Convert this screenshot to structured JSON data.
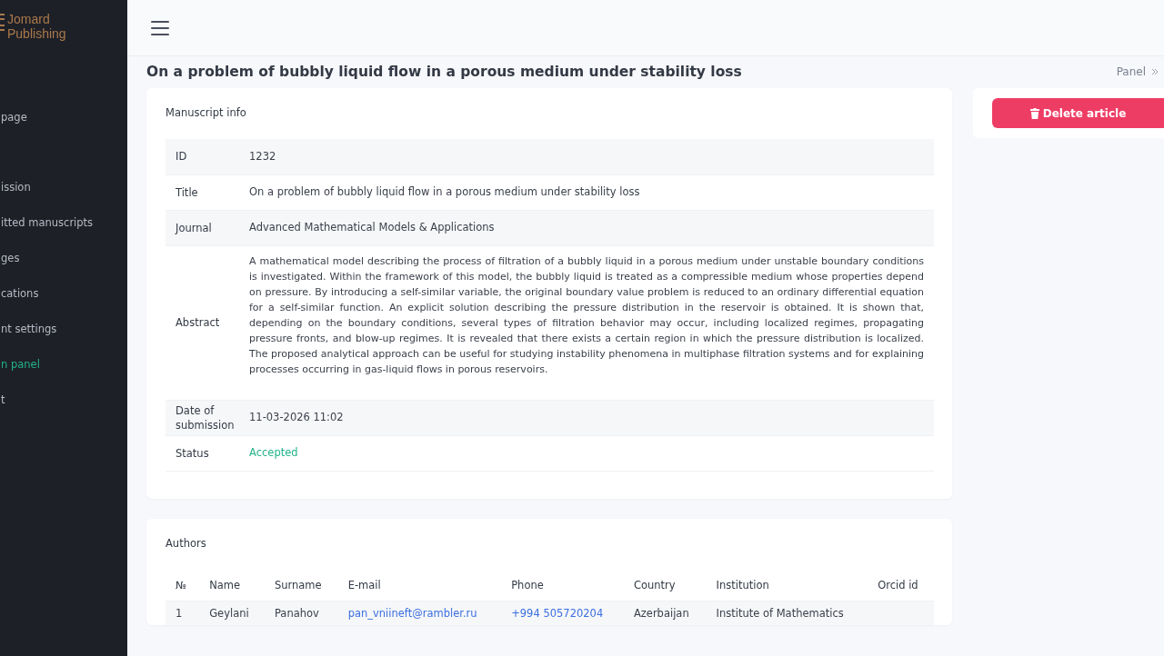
{
  "logo": {
    "lines": [
      "Jomard",
      "Publishing"
    ]
  },
  "sidebar": {
    "groups": [
      {
        "items": [
          {
            "label": "page",
            "selected": false
          }
        ]
      },
      {
        "items": [
          {
            "label": "ission",
            "selected": false
          },
          {
            "label": "itted manuscripts",
            "selected": false
          },
          {
            "label": "ges",
            "selected": false
          },
          {
            "label": "cations",
            "selected": false
          },
          {
            "label": "nt settings",
            "selected": false
          },
          {
            "label": "n panel",
            "selected": true
          },
          {
            "label": "t",
            "selected": false
          }
        ]
      }
    ]
  },
  "page_title": "On a problem of bubbly liquid flow in a porous medium under stability loss",
  "breadcrumb": "Panel",
  "delete_button": "Delete article",
  "manuscript": {
    "heading": "Manuscript info",
    "rows": [
      {
        "label": "ID",
        "value": "1232",
        "kind": "text"
      },
      {
        "label": "Title",
        "value": "On a problem of bubbly liquid flow in a porous medium under stability loss",
        "kind": "text"
      },
      {
        "label": "Journal",
        "value": "Advanced Mathematical Models & Applications",
        "kind": "text"
      },
      {
        "label": "Abstract",
        "value": "A mathematical model describing the process of filtration of a bubbly liquid in a porous medium under unstable boundary conditions is investigated. Within the framework of this model, the bubbly liquid is treated as a compressible medium whose properties depend on pressure. By introducing a self-similar variable, the original boundary value problem is reduced to an ordinary differential equation for a self-similar function. An explicit solution describing the pressure distribution in the reservoir is obtained. It is shown that, depending on the boundary conditions, several types of filtration behavior may occur, including localized regimes, propagating pressure fronts, and blow-up regimes. It is revealed that there exists a certain region in which the pressure distribution is localized. The proposed analytical approach can be useful for studying instability phenomena in multiphase filtration systems and for explaining processes occurring in gas-liquid flows in porous reservoirs.",
        "kind": "abstract"
      },
      {
        "label": "Date of submission",
        "value": "11-03-2026 11:02",
        "kind": "text"
      },
      {
        "label": "Status",
        "value": "Accepted",
        "kind": "status"
      }
    ]
  },
  "authors": {
    "heading": "Authors",
    "columns": [
      "№",
      "Name",
      "Surname",
      "E-mail",
      "Phone",
      "Country",
      "Institution",
      "Orcid id"
    ],
    "rows": [
      {
        "cells": [
          {
            "text": "1",
            "kind": "text"
          },
          {
            "text": "Geylani",
            "kind": "text"
          },
          {
            "text": "Panahov",
            "kind": "text"
          },
          {
            "text": "pan_vniineft@rambler.ru",
            "kind": "link"
          },
          {
            "text": "+994 505720204",
            "kind": "link"
          },
          {
            "text": "Azerbaijan",
            "kind": "text"
          },
          {
            "text": "Institute of Mathematics",
            "kind": "text"
          },
          {
            "text": "",
            "kind": "empty"
          }
        ]
      }
    ]
  }
}
